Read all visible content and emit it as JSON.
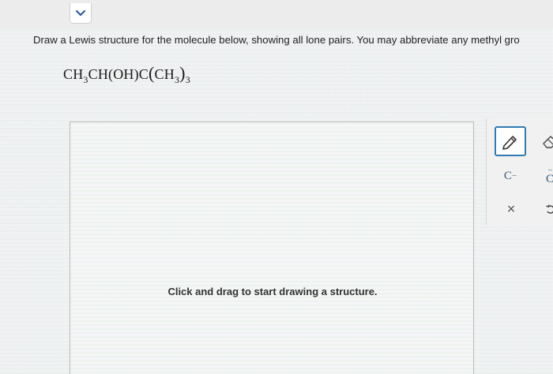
{
  "nav": {
    "chevron_icon": "chevron-down-icon"
  },
  "question": {
    "prompt": "Draw a Lewis structure for the molecule below, showing all lone pairs. You may abbreviate any methyl gro",
    "formula": {
      "part1": "CH",
      "sub1": "3",
      "part2": "CH(OH)C",
      "paren_open": "(",
      "part3": "CH",
      "sub2": "3",
      "paren_close": ")",
      "sub3": "3"
    }
  },
  "canvas": {
    "hint": "Click and drag to start drawing a structure."
  },
  "toolbar": {
    "tools": [
      {
        "name": "pencil-icon",
        "selected": true
      },
      {
        "name": "eraser-icon",
        "selected": false
      },
      {
        "name": "anion-charge",
        "label": "C",
        "mark": "−"
      },
      {
        "name": "lone-pair",
        "label": "C",
        "mark": "··"
      },
      {
        "name": "close-icon",
        "label": "×"
      },
      {
        "name": "undo-icon"
      }
    ],
    "accent_color": "#2e7bb3"
  }
}
